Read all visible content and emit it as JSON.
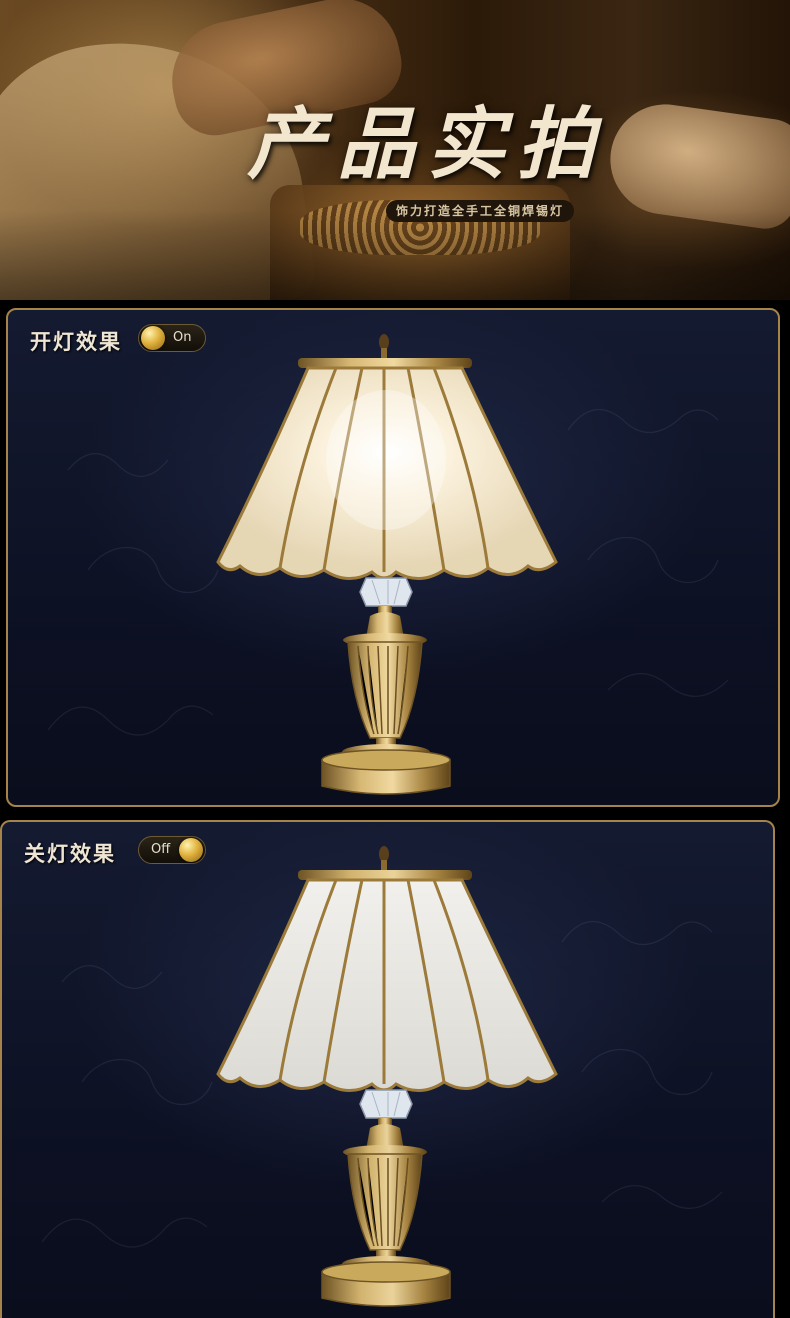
{
  "banner": {
    "title": "产品实拍",
    "subtitle": "饰力打造全手工全铜焊锡灯"
  },
  "panels": [
    {
      "label": "开灯效果",
      "toggle_label": "On",
      "state": "on"
    },
    {
      "label": "关灯效果",
      "toggle_label": "Off",
      "state": "off"
    }
  ],
  "colors": {
    "panel_border": "#a5834b",
    "panel_background": "#121830",
    "brass": "#b8964c",
    "glass_lit": "#fff6e2",
    "glass_unlit": "#ebe9e4"
  }
}
